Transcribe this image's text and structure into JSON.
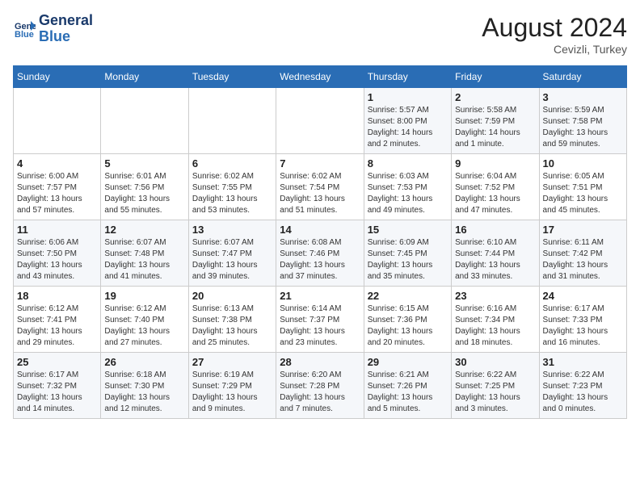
{
  "header": {
    "logo_line1": "General",
    "logo_line2": "Blue",
    "month_year": "August 2024",
    "location": "Cevizli, Turkey"
  },
  "weekdays": [
    "Sunday",
    "Monday",
    "Tuesday",
    "Wednesday",
    "Thursday",
    "Friday",
    "Saturday"
  ],
  "weeks": [
    [
      {
        "day": "",
        "text": ""
      },
      {
        "day": "",
        "text": ""
      },
      {
        "day": "",
        "text": ""
      },
      {
        "day": "",
        "text": ""
      },
      {
        "day": "1",
        "text": "Sunrise: 5:57 AM\nSunset: 8:00 PM\nDaylight: 14 hours\nand 2 minutes."
      },
      {
        "day": "2",
        "text": "Sunrise: 5:58 AM\nSunset: 7:59 PM\nDaylight: 14 hours\nand 1 minute."
      },
      {
        "day": "3",
        "text": "Sunrise: 5:59 AM\nSunset: 7:58 PM\nDaylight: 13 hours\nand 59 minutes."
      }
    ],
    [
      {
        "day": "4",
        "text": "Sunrise: 6:00 AM\nSunset: 7:57 PM\nDaylight: 13 hours\nand 57 minutes."
      },
      {
        "day": "5",
        "text": "Sunrise: 6:01 AM\nSunset: 7:56 PM\nDaylight: 13 hours\nand 55 minutes."
      },
      {
        "day": "6",
        "text": "Sunrise: 6:02 AM\nSunset: 7:55 PM\nDaylight: 13 hours\nand 53 minutes."
      },
      {
        "day": "7",
        "text": "Sunrise: 6:02 AM\nSunset: 7:54 PM\nDaylight: 13 hours\nand 51 minutes."
      },
      {
        "day": "8",
        "text": "Sunrise: 6:03 AM\nSunset: 7:53 PM\nDaylight: 13 hours\nand 49 minutes."
      },
      {
        "day": "9",
        "text": "Sunrise: 6:04 AM\nSunset: 7:52 PM\nDaylight: 13 hours\nand 47 minutes."
      },
      {
        "day": "10",
        "text": "Sunrise: 6:05 AM\nSunset: 7:51 PM\nDaylight: 13 hours\nand 45 minutes."
      }
    ],
    [
      {
        "day": "11",
        "text": "Sunrise: 6:06 AM\nSunset: 7:50 PM\nDaylight: 13 hours\nand 43 minutes."
      },
      {
        "day": "12",
        "text": "Sunrise: 6:07 AM\nSunset: 7:48 PM\nDaylight: 13 hours\nand 41 minutes."
      },
      {
        "day": "13",
        "text": "Sunrise: 6:07 AM\nSunset: 7:47 PM\nDaylight: 13 hours\nand 39 minutes."
      },
      {
        "day": "14",
        "text": "Sunrise: 6:08 AM\nSunset: 7:46 PM\nDaylight: 13 hours\nand 37 minutes."
      },
      {
        "day": "15",
        "text": "Sunrise: 6:09 AM\nSunset: 7:45 PM\nDaylight: 13 hours\nand 35 minutes."
      },
      {
        "day": "16",
        "text": "Sunrise: 6:10 AM\nSunset: 7:44 PM\nDaylight: 13 hours\nand 33 minutes."
      },
      {
        "day": "17",
        "text": "Sunrise: 6:11 AM\nSunset: 7:42 PM\nDaylight: 13 hours\nand 31 minutes."
      }
    ],
    [
      {
        "day": "18",
        "text": "Sunrise: 6:12 AM\nSunset: 7:41 PM\nDaylight: 13 hours\nand 29 minutes."
      },
      {
        "day": "19",
        "text": "Sunrise: 6:12 AM\nSunset: 7:40 PM\nDaylight: 13 hours\nand 27 minutes."
      },
      {
        "day": "20",
        "text": "Sunrise: 6:13 AM\nSunset: 7:38 PM\nDaylight: 13 hours\nand 25 minutes."
      },
      {
        "day": "21",
        "text": "Sunrise: 6:14 AM\nSunset: 7:37 PM\nDaylight: 13 hours\nand 23 minutes."
      },
      {
        "day": "22",
        "text": "Sunrise: 6:15 AM\nSunset: 7:36 PM\nDaylight: 13 hours\nand 20 minutes."
      },
      {
        "day": "23",
        "text": "Sunrise: 6:16 AM\nSunset: 7:34 PM\nDaylight: 13 hours\nand 18 minutes."
      },
      {
        "day": "24",
        "text": "Sunrise: 6:17 AM\nSunset: 7:33 PM\nDaylight: 13 hours\nand 16 minutes."
      }
    ],
    [
      {
        "day": "25",
        "text": "Sunrise: 6:17 AM\nSunset: 7:32 PM\nDaylight: 13 hours\nand 14 minutes."
      },
      {
        "day": "26",
        "text": "Sunrise: 6:18 AM\nSunset: 7:30 PM\nDaylight: 13 hours\nand 12 minutes."
      },
      {
        "day": "27",
        "text": "Sunrise: 6:19 AM\nSunset: 7:29 PM\nDaylight: 13 hours\nand 9 minutes."
      },
      {
        "day": "28",
        "text": "Sunrise: 6:20 AM\nSunset: 7:28 PM\nDaylight: 13 hours\nand 7 minutes."
      },
      {
        "day": "29",
        "text": "Sunrise: 6:21 AM\nSunset: 7:26 PM\nDaylight: 13 hours\nand 5 minutes."
      },
      {
        "day": "30",
        "text": "Sunrise: 6:22 AM\nSunset: 7:25 PM\nDaylight: 13 hours\nand 3 minutes."
      },
      {
        "day": "31",
        "text": "Sunrise: 6:22 AM\nSunset: 7:23 PM\nDaylight: 13 hours\nand 0 minutes."
      }
    ]
  ]
}
